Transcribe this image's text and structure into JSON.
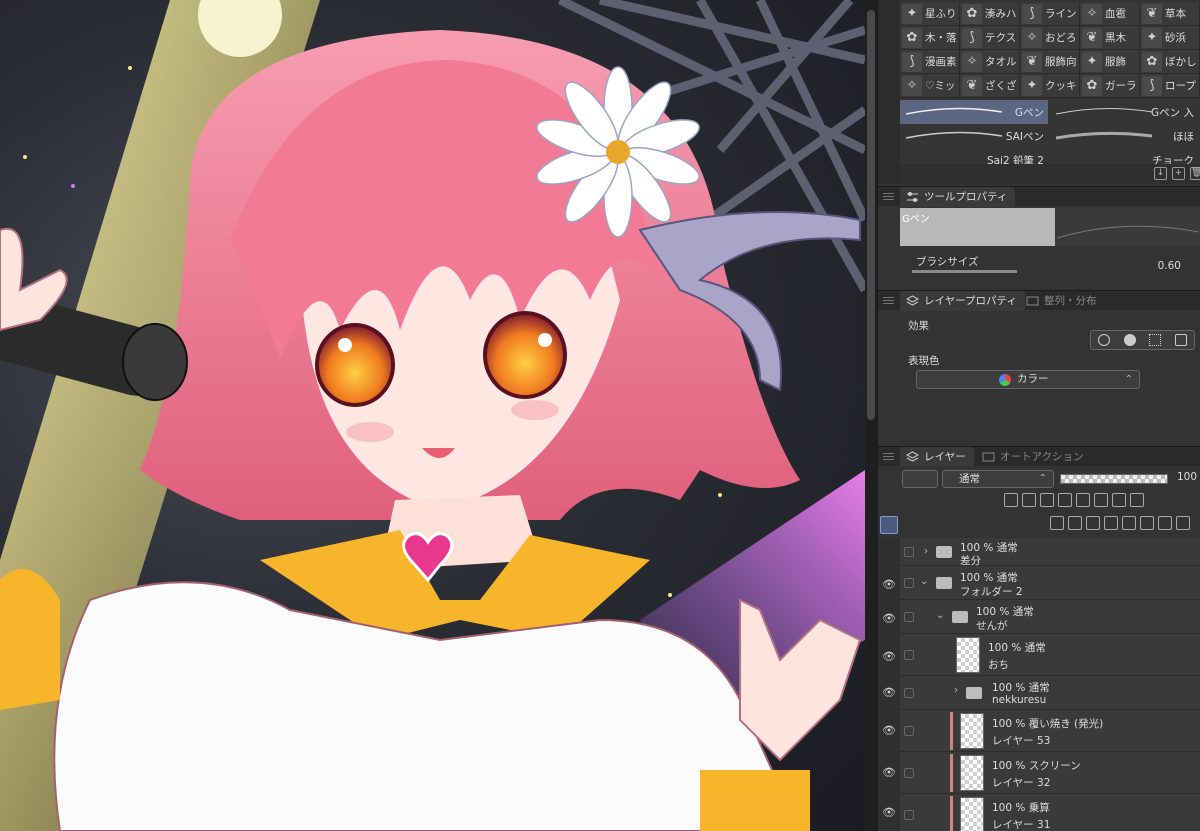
{
  "brushes": {
    "row1": [
      "星ふり",
      "湊みハ",
      "ライン",
      "血雹",
      "草本"
    ],
    "row2": [
      "木・落",
      "テクス",
      "おどろ",
      "黒木",
      "砂浜"
    ],
    "row3": [
      "漫画素",
      "タオル",
      "服飾向",
      "服飾",
      "ぼかし"
    ],
    "row4": [
      "♡ミッ",
      "ざくざ",
      "クッキ",
      "ガーラ",
      "ロープ"
    ]
  },
  "strokes": {
    "gpen": "Gペン",
    "gpen_in": "Gペン 入",
    "sai": "SAIペン",
    "hoho": "ほほ",
    "sai2": "Sai2 鉛筆 2",
    "chalk": "チョーク"
  },
  "tool_property": {
    "tab": "ツールプロパティ",
    "preview_label": "Gペン",
    "size_label": "ブラシサイズ",
    "size_value": "0.60"
  },
  "layer_property": {
    "tab": "レイヤープロパティ",
    "tab2": "整列・分布",
    "effect_label": "効果",
    "expression_label": "表現色",
    "expression_value": "カラー"
  },
  "layer_palette": {
    "tab": "レイヤー",
    "tab2": "オートアクション",
    "blend": "通常",
    "opacity": "100"
  },
  "layers": [
    {
      "mode": "100 % 通常",
      "name": "差分",
      "type": "folder",
      "visible": false,
      "collapsed": true
    },
    {
      "mode": "100 % 通常",
      "name": "フォルダー 2",
      "type": "folder",
      "visible": true,
      "collapsed": false
    },
    {
      "mode": "100 % 通常",
      "name": "せんが",
      "type": "folder",
      "visible": true,
      "collapsed": false
    },
    {
      "mode": "100 % 通常",
      "name": "おち",
      "type": "layer",
      "visible": true
    },
    {
      "mode": "100 % 通常",
      "name": "nekkuresu",
      "type": "folder",
      "visible": true,
      "collapsed": true
    },
    {
      "mode": "100 % 覆い焼き (発光)",
      "name": "レイヤー 53",
      "type": "layer",
      "visible": true,
      "clipped": true
    },
    {
      "mode": "100 % スクリーン",
      "name": "レイヤー 32",
      "type": "layer",
      "visible": true,
      "clipped": true
    },
    {
      "mode": "100 % 乗算",
      "name": "レイヤー 31",
      "type": "layer",
      "visible": true,
      "clipped": true
    }
  ],
  "colors": {
    "hair": "#f08aa0",
    "eye": "#f0a030",
    "accent": "#5a6682",
    "collar": "#f7b52b",
    "heart": "#e8378f"
  }
}
